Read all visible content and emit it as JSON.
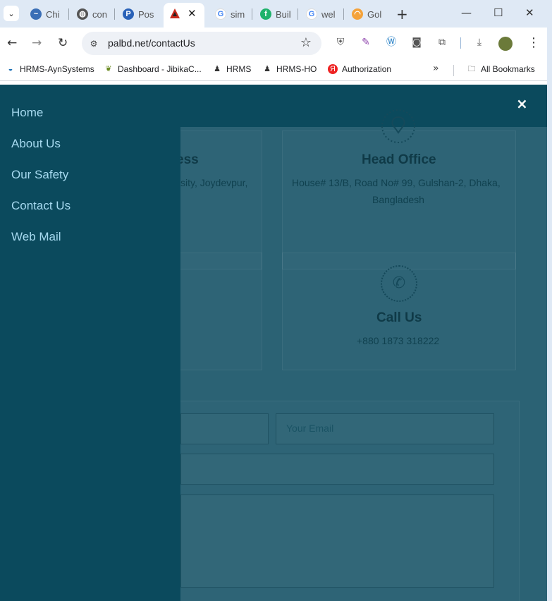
{
  "tabs": [
    {
      "label": "Chi",
      "icon": "chrome-swirl-icon"
    },
    {
      "label": "con",
      "icon": "globe-icon"
    },
    {
      "label": "Pos",
      "icon": "p-logo-icon"
    },
    {
      "label": "",
      "icon": "red-triangle-logo-icon",
      "active": true
    },
    {
      "label": "sim",
      "icon": "google-g-icon"
    },
    {
      "label": "Buil",
      "icon": "fi-logo-icon"
    },
    {
      "label": "wel",
      "icon": "google-g-icon"
    },
    {
      "label": "Gol",
      "icon": "rainbow-icon"
    }
  ],
  "address_bar": {
    "url": "palbd.net/contactUs"
  },
  "bookmarks": [
    {
      "label": "HRMS-AynSystems"
    },
    {
      "label": "Dashboard - JibikaC..."
    },
    {
      "label": "HRMS"
    },
    {
      "label": "HRMS-HO"
    },
    {
      "label": "Authorization"
    }
  ],
  "bookmarks_overflow": "»",
  "all_bookmarks": "All Bookmarks",
  "side_menu": {
    "items": [
      "Home",
      "About Us",
      "Our Safety",
      "Contact Us",
      "Web Mail"
    ],
    "close": "×"
  },
  "contact": {
    "address_title_partial": "ess",
    "address_text_partial": "sity, Joydevpur,",
    "head_office_title": "Head Office",
    "head_office_line1": "House# 13/B, Road No# 99, Gulshan-2, Dhaka,",
    "head_office_line2": "Bangladesh",
    "call_title": "Call Us",
    "call_number": "+880 1873 318222",
    "email_placeholder": "Your Email"
  },
  "colors": {
    "menu_bg": "#0b4a5d",
    "menu_text": "#a6d9ef",
    "page_overlay": "#2b6274"
  }
}
